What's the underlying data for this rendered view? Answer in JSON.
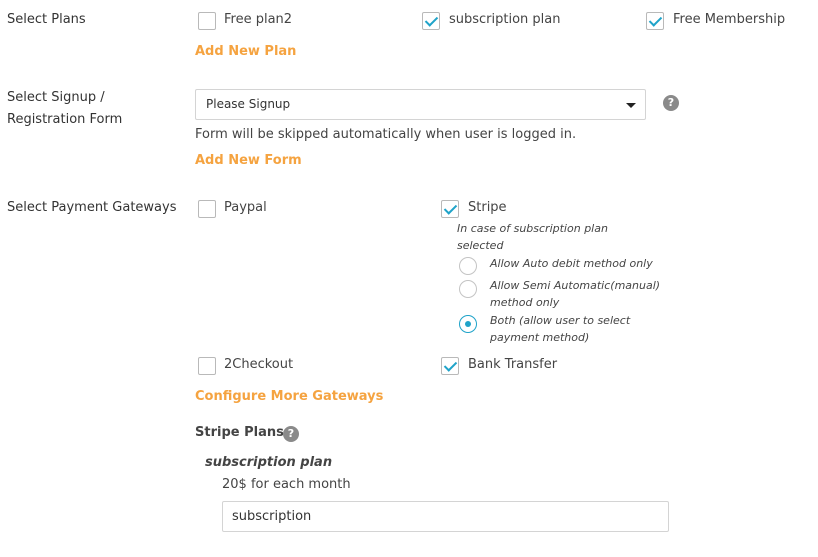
{
  "plans": {
    "label": "Select Plans",
    "items": [
      {
        "label": "Free plan2",
        "checked": false
      },
      {
        "label": "subscription plan",
        "checked": true
      },
      {
        "label": "Free Membership",
        "checked": true
      }
    ],
    "add_link": "Add New Plan"
  },
  "signup": {
    "label_line1": "Select Signup /",
    "label_line2": "Registration Form",
    "selected": "Please Signup",
    "note": "Form will be skipped automatically when user is logged in.",
    "add_link": "Add New Form",
    "help": "?"
  },
  "gateways": {
    "label": "Select Payment Gateways",
    "items": [
      {
        "label": "Paypal",
        "checked": false
      },
      {
        "label": "Stripe",
        "checked": true
      },
      {
        "label": "2Checkout",
        "checked": false
      },
      {
        "label": "Bank Transfer",
        "checked": true
      }
    ],
    "stripe_note_line1": "In case of subscription plan",
    "stripe_note_line2": "selected",
    "radio_options": [
      {
        "line1": "Allow Auto debit method only",
        "line2": "",
        "selected": false
      },
      {
        "line1": "Allow Semi Automatic(manual)",
        "line2": "method only",
        "selected": false
      },
      {
        "line1": "Both (allow user to select",
        "line2": "payment method)",
        "selected": true
      }
    ],
    "configure_link": "Configure More Gateways"
  },
  "stripe_plans": {
    "title": "Stripe Plans",
    "help": "?",
    "plan_name": "subscription plan",
    "plan_price": "20$ for each month",
    "plan_id_value": "subscription"
  },
  "colors": {
    "accent_link": "#f5a340",
    "check_blue": "#1fa3c9"
  }
}
